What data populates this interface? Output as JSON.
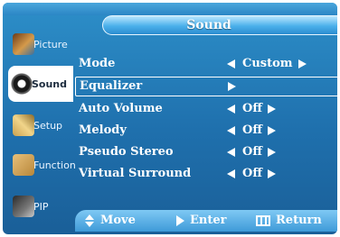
{
  "header": {
    "title": "Sound"
  },
  "sidebar": {
    "items": [
      {
        "label": "Picture",
        "icon": "picture-icon"
      },
      {
        "label": "Sound",
        "icon": "sound-icon",
        "active": true
      },
      {
        "label": "Setup",
        "icon": "setup-icon"
      },
      {
        "label": "Function",
        "icon": "function-icon"
      },
      {
        "label": "PIP",
        "icon": "pip-icon"
      }
    ]
  },
  "menu": {
    "items": [
      {
        "label": "Mode",
        "value": "Custom"
      },
      {
        "label": "Equalizer",
        "value": ""
      },
      {
        "label": "Auto Volume",
        "value": "Off"
      },
      {
        "label": "Melody",
        "value": "Off"
      },
      {
        "label": "Pseudo Stereo",
        "value": "Off"
      },
      {
        "label": "Virtual Surround",
        "value": "Off"
      }
    ]
  },
  "footer": {
    "move": "Move",
    "enter": "Enter",
    "return": "Return"
  },
  "colors": {
    "background": "#1f70ad",
    "accent": "#4ab0ea",
    "text": "#ffffff"
  }
}
